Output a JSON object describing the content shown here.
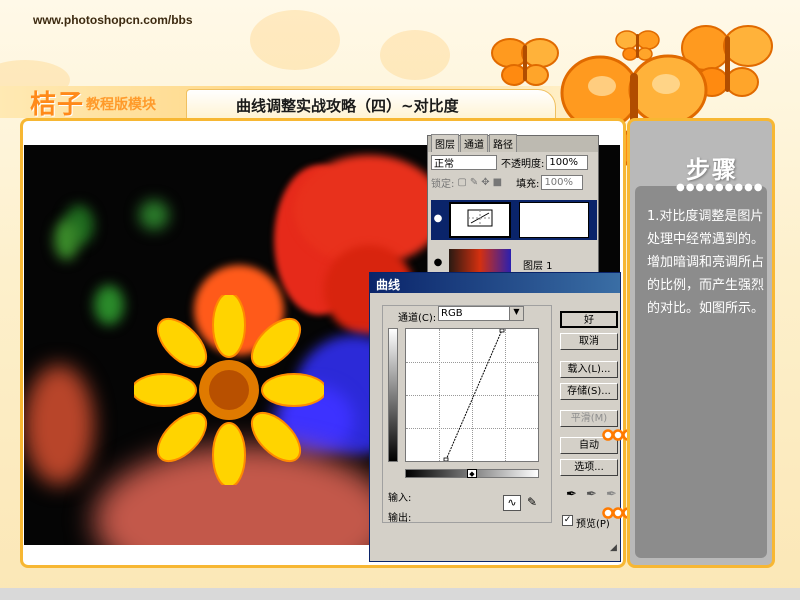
{
  "site": {
    "url": "www.photoshopcn.com/bbs"
  },
  "header": {
    "brand_main": "桔子",
    "brand_sub": "教程版模块",
    "title": "曲线调整实战攻略（四）~对比度"
  },
  "side": {
    "title": "步骤",
    "body": "1.对比度调整是图片处理中经常遇到的。增加暗调和亮调所占的比例，而产生强烈的对比。如图所示。"
  },
  "layers_panel": {
    "tabs": [
      "图层",
      "通道",
      "路径"
    ],
    "blend_mode": "正常",
    "opacity_label": "不透明度:",
    "opacity_value": "100%",
    "lock_label": "锁定:",
    "fill_label": "填充:",
    "fill_value": "100%",
    "layer2_name": "图层 1"
  },
  "curves_dialog": {
    "title": "曲线",
    "channel_label": "通道(C):",
    "channel_value": "RGB",
    "buttons": {
      "ok": "好",
      "cancel": "取消",
      "load": "载入(L)...",
      "save": "存储(S)...",
      "smooth": "平滑(M)",
      "auto": "自动",
      "options": "选项..."
    },
    "input_label": "输入:",
    "output_label": "输出:",
    "preview_label": "预览(P)"
  },
  "colors": {
    "accent": "#f7b733",
    "title_orange": "#ff8a1a",
    "dialog_titlebar": "#0a246a"
  }
}
